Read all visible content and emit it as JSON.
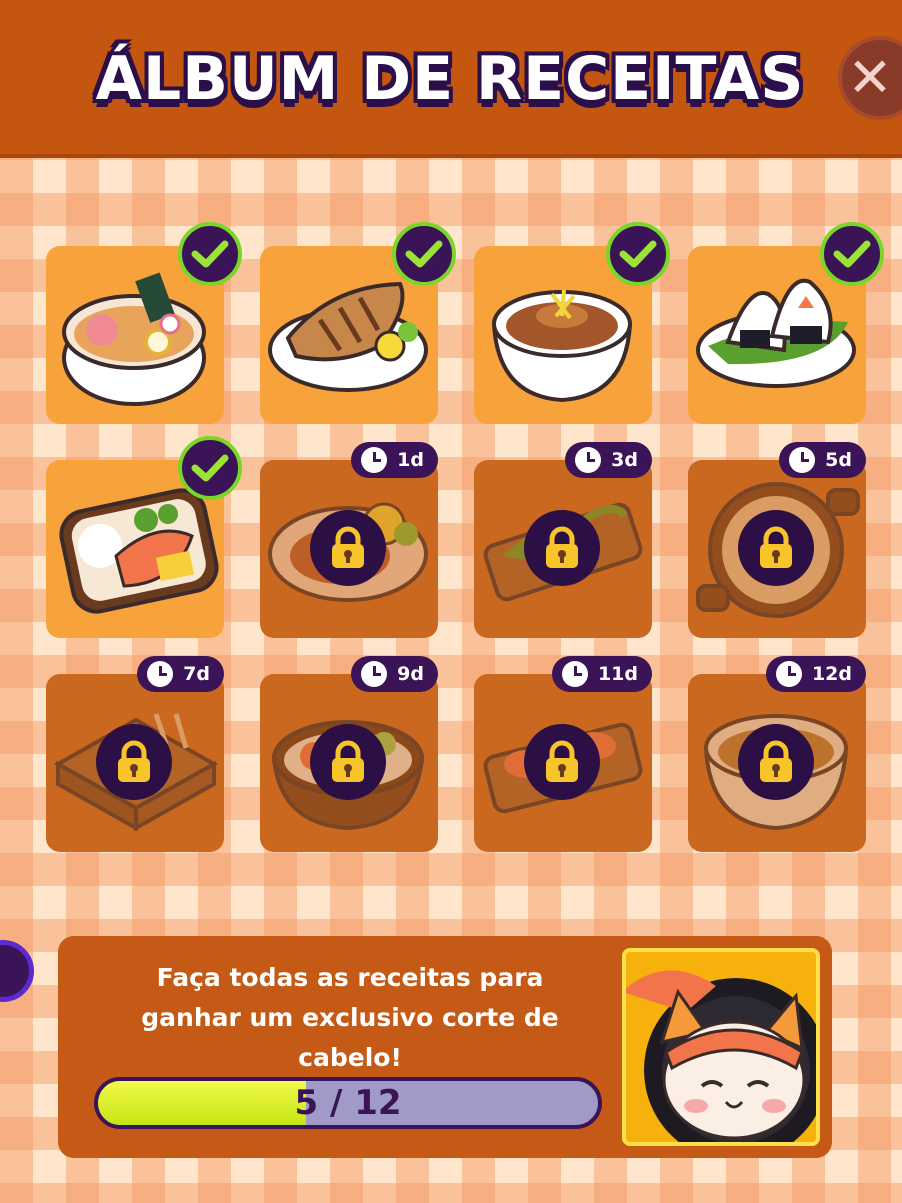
{
  "header": {
    "title": "ÁLBUM DE RECEITAS",
    "close_label": "✕"
  },
  "recipes": [
    {
      "dish": "ramen",
      "status": "unlocked"
    },
    {
      "dish": "grilled-fish",
      "status": "unlocked"
    },
    {
      "dish": "curry-bowl",
      "status": "unlocked"
    },
    {
      "dish": "onigiri",
      "status": "unlocked"
    },
    {
      "dish": "bento",
      "status": "unlocked"
    },
    {
      "dish": "fish-plate",
      "status": "locked",
      "timer": "1d"
    },
    {
      "dish": "sushi-board",
      "status": "locked",
      "timer": "3d"
    },
    {
      "dish": "rice-pan",
      "status": "locked",
      "timer": "5d"
    },
    {
      "dish": "yakitori-box",
      "status": "locked",
      "timer": "7d"
    },
    {
      "dish": "poke-bowl",
      "status": "locked",
      "timer": "9d"
    },
    {
      "dish": "sushi-platter",
      "status": "locked",
      "timer": "11d"
    },
    {
      "dish": "soup-bowl",
      "status": "locked",
      "timer": "12d"
    }
  ],
  "reward_panel": {
    "line1": "Faça todas as receitas para",
    "line2": "ganhar um exclusivo corte de",
    "line3": "cabelo!",
    "progress_text": "5 / 12",
    "progress_value": 5,
    "progress_max": 12,
    "reward_icon": "cat-sushi-haircut"
  },
  "colors": {
    "header": "#c4560f",
    "tile_done": "#f7a23a",
    "tile_locked": "#c9681e",
    "badge": "#3a1456",
    "check": "#7ad628",
    "progress": "#d8ee1e"
  }
}
